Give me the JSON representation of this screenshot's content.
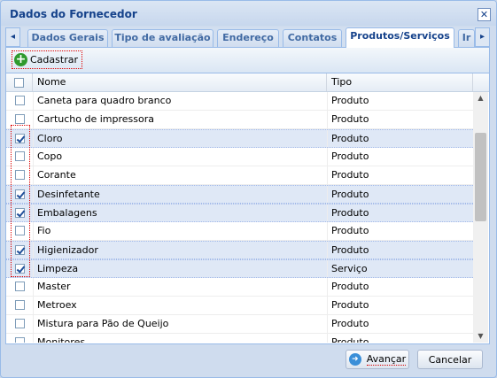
{
  "window": {
    "title": "Dados do Fornecedor",
    "close_glyph": "✕"
  },
  "tabs": {
    "scroll_left": "◂",
    "scroll_right": "▸",
    "items": [
      {
        "label": "Dados Gerais",
        "active": false
      },
      {
        "label": "Tipo de avaliação",
        "active": false
      },
      {
        "label": "Endereço",
        "active": false
      },
      {
        "label": "Contatos",
        "active": false
      },
      {
        "label": "Produtos/Serviços",
        "active": true
      },
      {
        "label": "Ir",
        "active": false
      }
    ]
  },
  "toolbar": {
    "add_label": "Cadastrar",
    "add_icon": "plus-circle-icon",
    "icon_color": "#2e9a2e"
  },
  "grid": {
    "columns": [
      "Nome",
      "Tipo"
    ],
    "rows": [
      {
        "name": "Caneta para quadro branco",
        "type": "Produto",
        "checked": false
      },
      {
        "name": "Cartucho de impressora",
        "type": "Produto",
        "checked": false
      },
      {
        "name": "Cloro",
        "type": "Produto",
        "checked": true
      },
      {
        "name": "Copo",
        "type": "Produto",
        "checked": false
      },
      {
        "name": "Corante",
        "type": "Produto",
        "checked": false
      },
      {
        "name": "Desinfetante",
        "type": "Produto",
        "checked": true
      },
      {
        "name": "Embalagens",
        "type": "Produto",
        "checked": true
      },
      {
        "name": "Fio",
        "type": "Produto",
        "checked": false
      },
      {
        "name": "Higienizador",
        "type": "Produto",
        "checked": true
      },
      {
        "name": "Limpeza",
        "type": "Serviço",
        "checked": true
      },
      {
        "name": "Master",
        "type": "Produto",
        "checked": false
      },
      {
        "name": "Metroex",
        "type": "Produto",
        "checked": false
      },
      {
        "name": "Mistura para Pão de Queijo",
        "type": "Produto",
        "checked": false
      },
      {
        "name": "Monitores",
        "type": "Produto",
        "checked": false
      }
    ],
    "scroll_up": "▲",
    "scroll_down": "▼"
  },
  "footer": {
    "next_label": "Avançar",
    "cancel_label": "Cancelar",
    "next_icon": "go-forward-icon"
  },
  "colors": {
    "header_text": "#15428b",
    "selection": "#dfe8f6",
    "highlight_border": "#dd0000"
  }
}
